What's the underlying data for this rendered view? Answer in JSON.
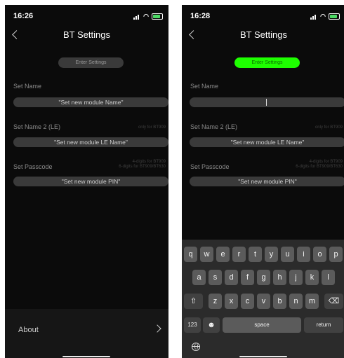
{
  "left": {
    "time": "16:26",
    "title": "BT Settings",
    "enter_settings": "Enter Settings",
    "set_name_label": "Set Name",
    "set_name_value": "\"Set new module Name\"",
    "set_name2_label": "Set Name 2 (LE)",
    "set_name2_hint": "only for BT909",
    "set_name2_value": "\"Set new module LE Name\"",
    "passcode_label": "Set Passcode",
    "passcode_hint_1": "4-digits for BT909",
    "passcode_hint_2": "6-digits for BT909/BT630",
    "passcode_value": "\"Set new module PIN\"",
    "about_label": "About"
  },
  "right": {
    "time": "16:28",
    "title": "BT Settings",
    "enter_settings": "Enter Settings",
    "set_name_label": "Set Name",
    "set_name_value": "",
    "set_name2_label": "Set Name 2 (LE)",
    "set_name2_hint": "only for BT909",
    "set_name2_value": "\"Set new module LE Name\"",
    "passcode_label": "Set Passcode",
    "passcode_hint_1": "4-digits for BT909",
    "passcode_hint_2": "6-digits for BT909/BT630",
    "passcode_value": "\"Set new module PIN\"",
    "keyboard": {
      "row1": [
        "q",
        "w",
        "e",
        "r",
        "t",
        "y",
        "u",
        "i",
        "o",
        "p"
      ],
      "row2": [
        "a",
        "s",
        "d",
        "f",
        "g",
        "h",
        "j",
        "k",
        "l"
      ],
      "row3": [
        "z",
        "x",
        "c",
        "v",
        "b",
        "n",
        "m"
      ],
      "shift": "⇧",
      "delete": "⌫",
      "numbers": "123",
      "emoji": "☻",
      "space": "space",
      "return": "return"
    }
  },
  "colors": {
    "background": "#0b0b0b",
    "field": "#3a3a3a",
    "enter_active": "#1eff00",
    "battery": "#4cd964"
  }
}
